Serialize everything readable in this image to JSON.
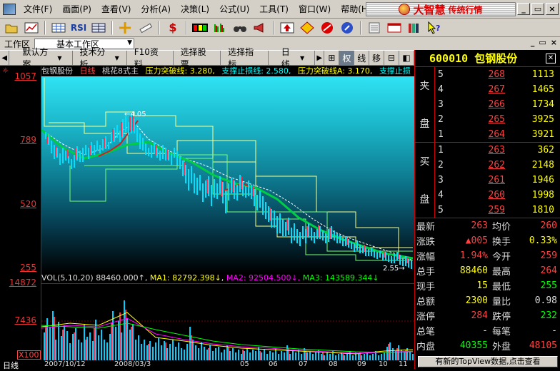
{
  "menu": {
    "items": [
      "文件(F)",
      "画面(P)",
      "查看(V)",
      "分析(A)",
      "决策(L)",
      "公式(U)",
      "工具(T)",
      "窗口(W)",
      "帮助(H)"
    ],
    "brand_name": "大智慧",
    "brand_sub": "传统行情"
  },
  "window_buttons": [
    "_",
    "▭",
    "×"
  ],
  "toolbar": {
    "buttons": [
      "open-icon",
      "chart-icon",
      "grid-icon",
      "rsi-icon",
      "table-icon",
      "pointer-plus-icon",
      "ruler-icon",
      "dollar-icon",
      "ticker-icon",
      "bars-icon",
      "binoculars-icon",
      "megaphone-icon",
      "up-arrow-icon",
      "diamond-icon",
      "prohibit-icon",
      "info-icon",
      "notepad-icon",
      "window-icon",
      "books-icon",
      "help-pointer-icon"
    ],
    "rsi_label": "RSI",
    "dollar_label": "$"
  },
  "workspace": {
    "label": "工作区",
    "selected": "基本工作区"
  },
  "funcbar": {
    "default_scheme": "默认方案",
    "tech_analysis": "技术分析",
    "f10": "F10资料",
    "select_stock": "选择股票",
    "select_indicator": "选择指标",
    "period": "日线",
    "squares": [
      "⊞",
      "权",
      "线",
      "移",
      "⊟",
      "◧"
    ]
  },
  "chart_header": {
    "stock_name": "包钢股份",
    "period": "日线",
    "indicator": "桃花8式主",
    "line1_label": "压力突破线: 3.280,",
    "line2_label": "支撑止损线: 2.580,",
    "line3_label": "压力突破线A: 3.170,",
    "line4_label": "支撑止损"
  },
  "vol_header": {
    "label": "VOL(5,10,20)",
    "vol": "88460.000↑,",
    "ma1": "MA1: 82792.398↓,",
    "ma2": "MA2: 92504.500↓,",
    "ma3": "MA3: 143589.344↓"
  },
  "y_axis": {
    "price_ticks": [
      "1057",
      "789",
      "520",
      "255"
    ],
    "vol_ticks": [
      "14872",
      "7436"
    ],
    "unit": "X100"
  },
  "x_axis": {
    "labels": [
      "日线",
      "2007/10/12",
      "2008/03/3",
      "05",
      "06",
      "07",
      "08",
      "09",
      "10",
      "11"
    ]
  },
  "annotations": {
    "high_label": "4.05",
    "low_label": "2.55"
  },
  "quote": {
    "code": "600010",
    "name": "包钢股份",
    "ask_label": [
      "夹",
      "盘"
    ],
    "bid_label": [
      "买",
      "盘"
    ],
    "asks": [
      {
        "level": "5",
        "price": "268",
        "vol": "1113"
      },
      {
        "level": "4",
        "price": "267",
        "vol": "1465"
      },
      {
        "level": "3",
        "price": "266",
        "vol": "1734"
      },
      {
        "level": "2",
        "price": "265",
        "vol": "3925"
      },
      {
        "level": "1",
        "price": "264",
        "vol": "3921"
      }
    ],
    "bids": [
      {
        "level": "1",
        "price": "263",
        "vol": "362"
      },
      {
        "level": "2",
        "price": "262",
        "vol": "2148"
      },
      {
        "level": "3",
        "price": "261",
        "vol": "1946"
      },
      {
        "level": "4",
        "price": "260",
        "vol": "1998"
      },
      {
        "level": "5",
        "price": "259",
        "vol": "1810"
      }
    ],
    "stats": [
      {
        "k": "最新",
        "v": "263",
        "vc": "red",
        "k2": "均价",
        "v2": "260",
        "v2c": "red"
      },
      {
        "k": "涨跌",
        "v": "▲005",
        "vc": "red",
        "k2": "换手",
        "v2": "0.33%",
        "v2c": "yel"
      },
      {
        "k": "涨幅",
        "v": "1.94%",
        "vc": "red",
        "k2": "今开",
        "v2": "259",
        "v2c": "red"
      },
      {
        "k": "总手",
        "v": "88460",
        "vc": "yel",
        "k2": "最高",
        "v2": "264",
        "v2c": "red"
      },
      {
        "k": "现手",
        "v": "15",
        "vc": "yel",
        "k2": "最低",
        "v2": "255",
        "v2c": "grn"
      },
      {
        "k": "总额",
        "v": "2300",
        "vc": "yel",
        "k2": "量比",
        "v2": "0.98",
        "v2c": "wht"
      },
      {
        "k": "涨停",
        "v": "284",
        "vc": "red",
        "k2": "跌停",
        "v2": "232",
        "v2c": "grn"
      },
      {
        "k": "总笔",
        "v": "-",
        "vc": "wht",
        "k2": "每笔",
        "v2": "-",
        "v2c": "wht"
      },
      {
        "k": "内盘",
        "v": "40355",
        "vc": "grn",
        "k2": "外盘",
        "v2": "48105",
        "v2c": "red"
      }
    ],
    "topview": "有新的TopView数据,点击查看"
  }
}
